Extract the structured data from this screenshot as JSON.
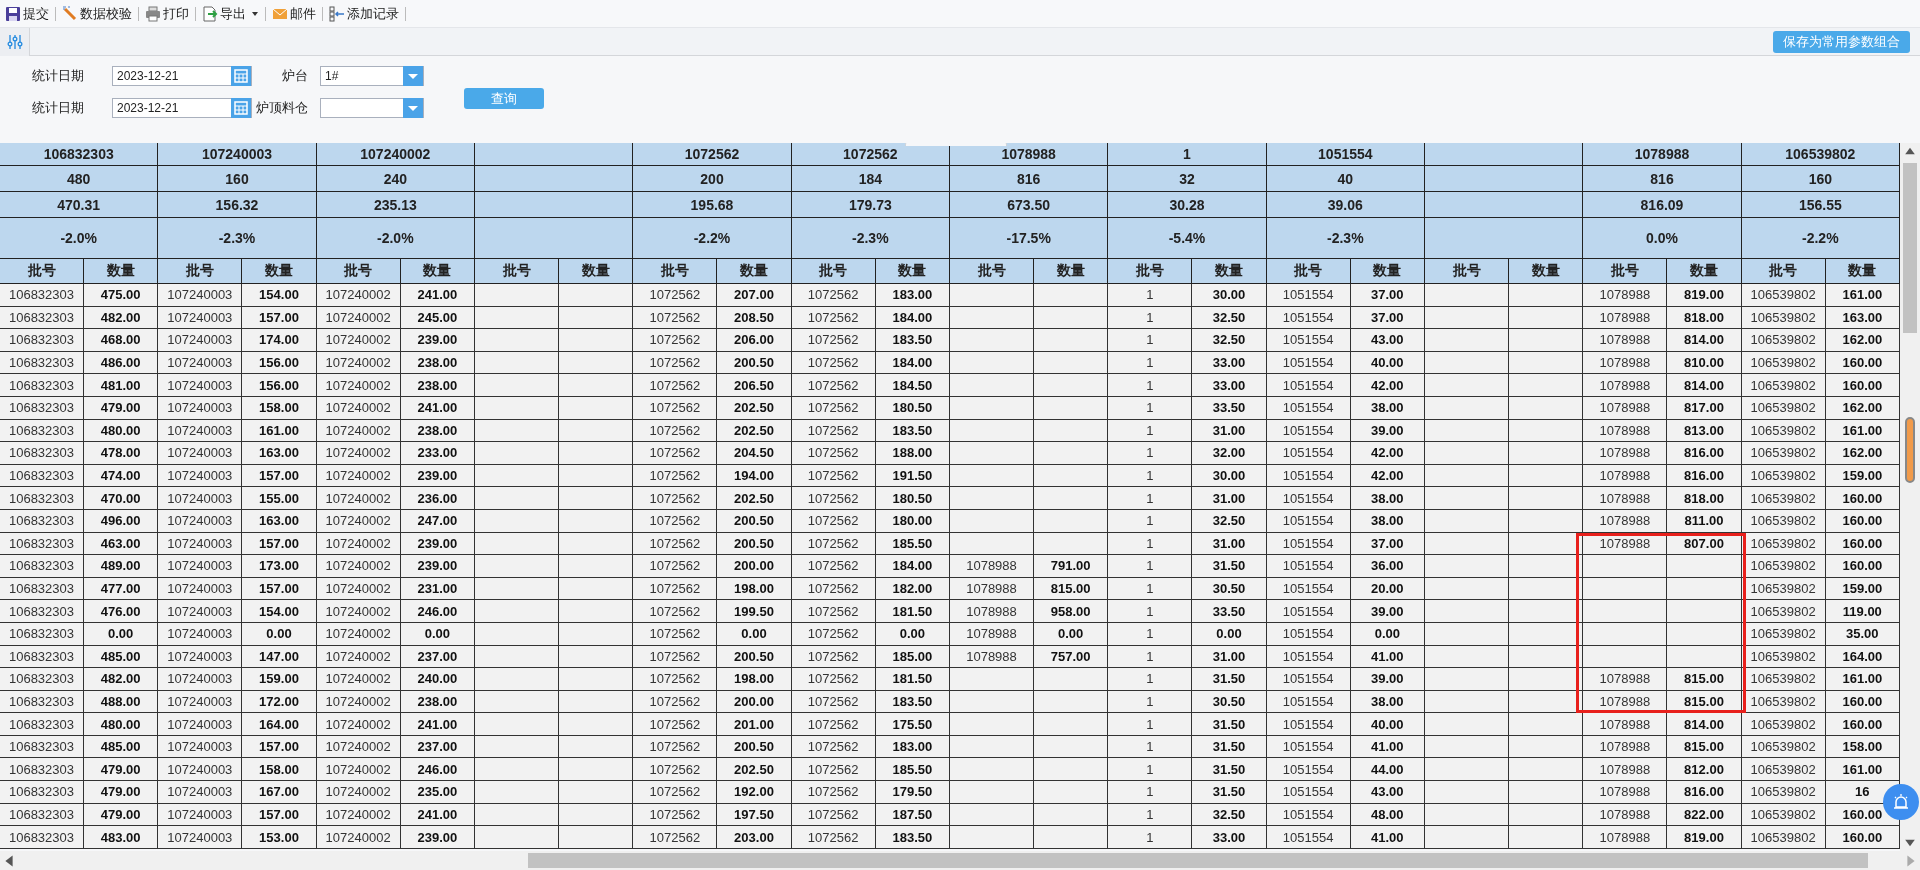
{
  "toolbar": {
    "items": [
      {
        "label": "提交",
        "dropdown": false
      },
      {
        "label": "数据校验",
        "dropdown": false
      },
      {
        "label": "打印",
        "dropdown": false
      },
      {
        "label": "导出",
        "dropdown": true
      },
      {
        "label": "邮件",
        "dropdown": false
      },
      {
        "label": "添加记录",
        "dropdown": false
      }
    ]
  },
  "filter_bar": {
    "save_button": "保存为常用参数组合"
  },
  "form": {
    "fields": [
      {
        "label": "统计日期",
        "kind": "date",
        "value": "2023-12-21"
      },
      {
        "label": "炉台",
        "kind": "select",
        "value": "1#"
      },
      {
        "label": "统计日期",
        "kind": "date",
        "value": "2023-12-21"
      },
      {
        "label": "炉顶料仓",
        "kind": "select"
      }
    ],
    "query_button": "查询"
  },
  "table": {
    "groups": [
      {
        "batch": "106832303",
        "plan": "480",
        "actual": "470.31",
        "deviation": "-2.0%",
        "columns": [
          "批号",
          "数量"
        ]
      },
      {
        "batch": "107240003",
        "plan": "160",
        "actual": "156.32",
        "deviation": "-2.3%",
        "columns": [
          "批号",
          "数量"
        ]
      },
      {
        "batch": "107240002",
        "plan": "240",
        "actual": "235.13",
        "deviation": "-2.0%",
        "columns": [
          "批号",
          "数量"
        ]
      },
      {
        "columns": [
          "批号",
          "数量"
        ]
      },
      {
        "batch": "1072562",
        "plan": "200",
        "actual": "195.68",
        "deviation": "-2.2%",
        "columns": [
          "批号",
          "数量"
        ]
      },
      {
        "batch": "1072562",
        "plan": "184",
        "actual": "179.73",
        "deviation": "-2.3%",
        "columns": [
          "批号",
          "数量"
        ]
      },
      {
        "batch": "1078988",
        "plan": "816",
        "actual": "673.50",
        "deviation": "-17.5%",
        "columns": [
          "批号",
          "数量"
        ]
      },
      {
        "batch": "1",
        "plan": "32",
        "actual": "30.28",
        "deviation": "-5.4%",
        "columns": [
          "批号",
          "数量"
        ]
      },
      {
        "batch": "1051554",
        "plan": "40",
        "actual": "39.06",
        "deviation": "-2.3%",
        "columns": [
          "批号",
          "数量"
        ]
      },
      {
        "columns": [
          "批号",
          "数量"
        ]
      },
      {
        "batch": "1078988",
        "plan": "816",
        "actual": "816.09",
        "deviation": "0.0%",
        "columns": [
          "批号",
          "数量"
        ]
      },
      {
        "batch": "106539802",
        "plan": "160",
        "actual": "156.55",
        "deviation": "-2.2%",
        "columns": [
          "批号",
          "数量"
        ]
      }
    ],
    "rows": [
      [
        [
          "106832303",
          "475.00"
        ],
        [
          "107240003",
          "154.00"
        ],
        [
          "107240002",
          "241.00"
        ],
        null,
        [
          "1072562",
          "207.00"
        ],
        [
          "1072562",
          "183.00"
        ],
        null,
        [
          "1",
          "30.00"
        ],
        [
          "1051554",
          "37.00"
        ],
        null,
        [
          "1078988",
          "819.00"
        ],
        [
          "106539802",
          "161.00"
        ]
      ],
      [
        [
          "106832303",
          "482.00"
        ],
        [
          "107240003",
          "157.00"
        ],
        [
          "107240002",
          "245.00"
        ],
        null,
        [
          "1072562",
          "208.50"
        ],
        [
          "1072562",
          "184.00"
        ],
        null,
        [
          "1",
          "32.50"
        ],
        [
          "1051554",
          "37.00"
        ],
        null,
        [
          "1078988",
          "818.00"
        ],
        [
          "106539802",
          "163.00"
        ]
      ],
      [
        [
          "106832303",
          "468.00"
        ],
        [
          "107240003",
          "174.00"
        ],
        [
          "107240002",
          "239.00"
        ],
        null,
        [
          "1072562",
          "206.00"
        ],
        [
          "1072562",
          "183.50"
        ],
        null,
        [
          "1",
          "32.50"
        ],
        [
          "1051554",
          "43.00"
        ],
        null,
        [
          "1078988",
          "814.00"
        ],
        [
          "106539802",
          "162.00"
        ]
      ],
      [
        [
          "106832303",
          "486.00"
        ],
        [
          "107240003",
          "156.00"
        ],
        [
          "107240002",
          "238.00"
        ],
        null,
        [
          "1072562",
          "200.50"
        ],
        [
          "1072562",
          "184.00"
        ],
        null,
        [
          "1",
          "33.00"
        ],
        [
          "1051554",
          "40.00"
        ],
        null,
        [
          "1078988",
          "810.00"
        ],
        [
          "106539802",
          "160.00"
        ]
      ],
      [
        [
          "106832303",
          "481.00"
        ],
        [
          "107240003",
          "156.00"
        ],
        [
          "107240002",
          "238.00"
        ],
        null,
        [
          "1072562",
          "206.50"
        ],
        [
          "1072562",
          "184.50"
        ],
        null,
        [
          "1",
          "33.00"
        ],
        [
          "1051554",
          "42.00"
        ],
        null,
        [
          "1078988",
          "814.00"
        ],
        [
          "106539802",
          "160.00"
        ]
      ],
      [
        [
          "106832303",
          "479.00"
        ],
        [
          "107240003",
          "158.00"
        ],
        [
          "107240002",
          "241.00"
        ],
        null,
        [
          "1072562",
          "202.50"
        ],
        [
          "1072562",
          "180.50"
        ],
        null,
        [
          "1",
          "33.50"
        ],
        [
          "1051554",
          "38.00"
        ],
        null,
        [
          "1078988",
          "817.00"
        ],
        [
          "106539802",
          "162.00"
        ]
      ],
      [
        [
          "106832303",
          "480.00"
        ],
        [
          "107240003",
          "161.00"
        ],
        [
          "107240002",
          "238.00"
        ],
        null,
        [
          "1072562",
          "202.50"
        ],
        [
          "1072562",
          "183.50"
        ],
        null,
        [
          "1",
          "31.00"
        ],
        [
          "1051554",
          "39.00"
        ],
        null,
        [
          "1078988",
          "813.00"
        ],
        [
          "106539802",
          "161.00"
        ]
      ],
      [
        [
          "106832303",
          "478.00"
        ],
        [
          "107240003",
          "163.00"
        ],
        [
          "107240002",
          "233.00"
        ],
        null,
        [
          "1072562",
          "204.50"
        ],
        [
          "1072562",
          "188.00"
        ],
        null,
        [
          "1",
          "32.00"
        ],
        [
          "1051554",
          "42.00"
        ],
        null,
        [
          "1078988",
          "816.00"
        ],
        [
          "106539802",
          "162.00"
        ]
      ],
      [
        [
          "106832303",
          "474.00"
        ],
        [
          "107240003",
          "157.00"
        ],
        [
          "107240002",
          "239.00"
        ],
        null,
        [
          "1072562",
          "194.00"
        ],
        [
          "1072562",
          "191.50"
        ],
        null,
        [
          "1",
          "30.00"
        ],
        [
          "1051554",
          "42.00"
        ],
        null,
        [
          "1078988",
          "816.00"
        ],
        [
          "106539802",
          "159.00"
        ]
      ],
      [
        [
          "106832303",
          "470.00"
        ],
        [
          "107240003",
          "155.00"
        ],
        [
          "107240002",
          "236.00"
        ],
        null,
        [
          "1072562",
          "202.50"
        ],
        [
          "1072562",
          "180.50"
        ],
        null,
        [
          "1",
          "31.00"
        ],
        [
          "1051554",
          "38.00"
        ],
        null,
        [
          "1078988",
          "818.00"
        ],
        [
          "106539802",
          "160.00"
        ]
      ],
      [
        [
          "106832303",
          "496.00"
        ],
        [
          "107240003",
          "163.00"
        ],
        [
          "107240002",
          "247.00"
        ],
        null,
        [
          "1072562",
          "200.50"
        ],
        [
          "1072562",
          "180.00"
        ],
        null,
        [
          "1",
          "32.50"
        ],
        [
          "1051554",
          "38.00"
        ],
        null,
        [
          "1078988",
          "811.00"
        ],
        [
          "106539802",
          "160.00"
        ]
      ],
      [
        [
          "106832303",
          "463.00"
        ],
        [
          "107240003",
          "157.00"
        ],
        [
          "107240002",
          "239.00"
        ],
        null,
        [
          "1072562",
          "200.50"
        ],
        [
          "1072562",
          "185.50"
        ],
        null,
        [
          "1",
          "31.00"
        ],
        [
          "1051554",
          "37.00"
        ],
        null,
        [
          "1078988",
          "807.00"
        ],
        [
          "106539802",
          "160.00"
        ]
      ],
      [
        [
          "106832303",
          "489.00"
        ],
        [
          "107240003",
          "173.00"
        ],
        [
          "107240002",
          "239.00"
        ],
        null,
        [
          "1072562",
          "200.00"
        ],
        [
          "1072562",
          "184.00"
        ],
        [
          "1078988",
          "791.00"
        ],
        [
          "1",
          "31.50"
        ],
        [
          "1051554",
          "36.00"
        ],
        null,
        null,
        [
          "106539802",
          "160.00"
        ]
      ],
      [
        [
          "106832303",
          "477.00"
        ],
        [
          "107240003",
          "157.00"
        ],
        [
          "107240002",
          "231.00"
        ],
        null,
        [
          "1072562",
          "198.00"
        ],
        [
          "1072562",
          "182.00"
        ],
        [
          "1078988",
          "815.00"
        ],
        [
          "1",
          "30.50"
        ],
        [
          "1051554",
          "20.00"
        ],
        null,
        null,
        [
          "106539802",
          "159.00"
        ]
      ],
      [
        [
          "106832303",
          "476.00"
        ],
        [
          "107240003",
          "154.00"
        ],
        [
          "107240002",
          "246.00"
        ],
        null,
        [
          "1072562",
          "199.50"
        ],
        [
          "1072562",
          "181.50"
        ],
        [
          "1078988",
          "958.00"
        ],
        [
          "1",
          "33.50"
        ],
        [
          "1051554",
          "39.00"
        ],
        null,
        null,
        [
          "106539802",
          "119.00"
        ]
      ],
      [
        [
          "106832303",
          "0.00"
        ],
        [
          "107240003",
          "0.00"
        ],
        [
          "107240002",
          "0.00"
        ],
        null,
        [
          "1072562",
          "0.00"
        ],
        [
          "1072562",
          "0.00"
        ],
        [
          "1078988",
          "0.00"
        ],
        [
          "1",
          "0.00"
        ],
        [
          "1051554",
          "0.00"
        ],
        null,
        null,
        [
          "106539802",
          "35.00"
        ]
      ],
      [
        [
          "106832303",
          "485.00"
        ],
        [
          "107240003",
          "147.00"
        ],
        [
          "107240002",
          "237.00"
        ],
        null,
        [
          "1072562",
          "200.50"
        ],
        [
          "1072562",
          "185.00"
        ],
        [
          "1078988",
          "757.00"
        ],
        [
          "1",
          "31.00"
        ],
        [
          "1051554",
          "41.00"
        ],
        null,
        null,
        [
          "106539802",
          "164.00"
        ]
      ],
      [
        [
          "106832303",
          "482.00"
        ],
        [
          "107240003",
          "159.00"
        ],
        [
          "107240002",
          "240.00"
        ],
        null,
        [
          "1072562",
          "198.00"
        ],
        [
          "1072562",
          "181.50"
        ],
        null,
        [
          "1",
          "31.50"
        ],
        [
          "1051554",
          "39.00"
        ],
        null,
        [
          "1078988",
          "815.00"
        ],
        [
          "106539802",
          "161.00"
        ]
      ],
      [
        [
          "106832303",
          "488.00"
        ],
        [
          "107240003",
          "172.00"
        ],
        [
          "107240002",
          "238.00"
        ],
        null,
        [
          "1072562",
          "200.00"
        ],
        [
          "1072562",
          "183.50"
        ],
        null,
        [
          "1",
          "30.50"
        ],
        [
          "1051554",
          "38.00"
        ],
        null,
        [
          "1078988",
          "815.00"
        ],
        [
          "106539802",
          "160.00"
        ]
      ],
      [
        [
          "106832303",
          "480.00"
        ],
        [
          "107240003",
          "164.00"
        ],
        [
          "107240002",
          "241.00"
        ],
        null,
        [
          "1072562",
          "201.00"
        ],
        [
          "1072562",
          "175.50"
        ],
        null,
        [
          "1",
          "31.50"
        ],
        [
          "1051554",
          "40.00"
        ],
        null,
        [
          "1078988",
          "814.00"
        ],
        [
          "106539802",
          "160.00"
        ]
      ],
      [
        [
          "106832303",
          "485.00"
        ],
        [
          "107240003",
          "157.00"
        ],
        [
          "107240002",
          "237.00"
        ],
        null,
        [
          "1072562",
          "200.50"
        ],
        [
          "1072562",
          "183.00"
        ],
        null,
        [
          "1",
          "31.50"
        ],
        [
          "1051554",
          "41.00"
        ],
        null,
        [
          "1078988",
          "815.00"
        ],
        [
          "106539802",
          "158.00"
        ]
      ],
      [
        [
          "106832303",
          "479.00"
        ],
        [
          "107240003",
          "158.00"
        ],
        [
          "107240002",
          "246.00"
        ],
        null,
        [
          "1072562",
          "202.50"
        ],
        [
          "1072562",
          "185.50"
        ],
        null,
        [
          "1",
          "31.50"
        ],
        [
          "1051554",
          "44.00"
        ],
        null,
        [
          "1078988",
          "812.00"
        ],
        [
          "106539802",
          "161.00"
        ]
      ],
      [
        [
          "106832303",
          "479.00"
        ],
        [
          "107240003",
          "167.00"
        ],
        [
          "107240002",
          "235.00"
        ],
        null,
        [
          "1072562",
          "192.00"
        ],
        [
          "1072562",
          "179.50"
        ],
        null,
        [
          "1",
          "31.50"
        ],
        [
          "1051554",
          "43.00"
        ],
        null,
        [
          "1078988",
          "816.00"
        ],
        [
          "106539802",
          "16"
        ]
      ],
      [
        [
          "106832303",
          "479.00"
        ],
        [
          "107240003",
          "157.00"
        ],
        [
          "107240002",
          "241.00"
        ],
        null,
        [
          "1072562",
          "197.50"
        ],
        [
          "1072562",
          "187.50"
        ],
        null,
        [
          "1",
          "32.50"
        ],
        [
          "1051554",
          "48.00"
        ],
        null,
        [
          "1078988",
          "822.00"
        ],
        [
          "106539802",
          "160.00"
        ]
      ],
      [
        [
          "106832303",
          "483.00"
        ],
        [
          "107240003",
          "153.00"
        ],
        [
          "107240002",
          "239.00"
        ],
        null,
        [
          "1072562",
          "203.00"
        ],
        [
          "1072562",
          "183.50"
        ],
        null,
        [
          "1",
          "33.00"
        ],
        [
          "1051554",
          "41.00"
        ],
        null,
        [
          "1078988",
          "819.00"
        ],
        [
          "106539802",
          "160.00"
        ]
      ]
    ]
  }
}
